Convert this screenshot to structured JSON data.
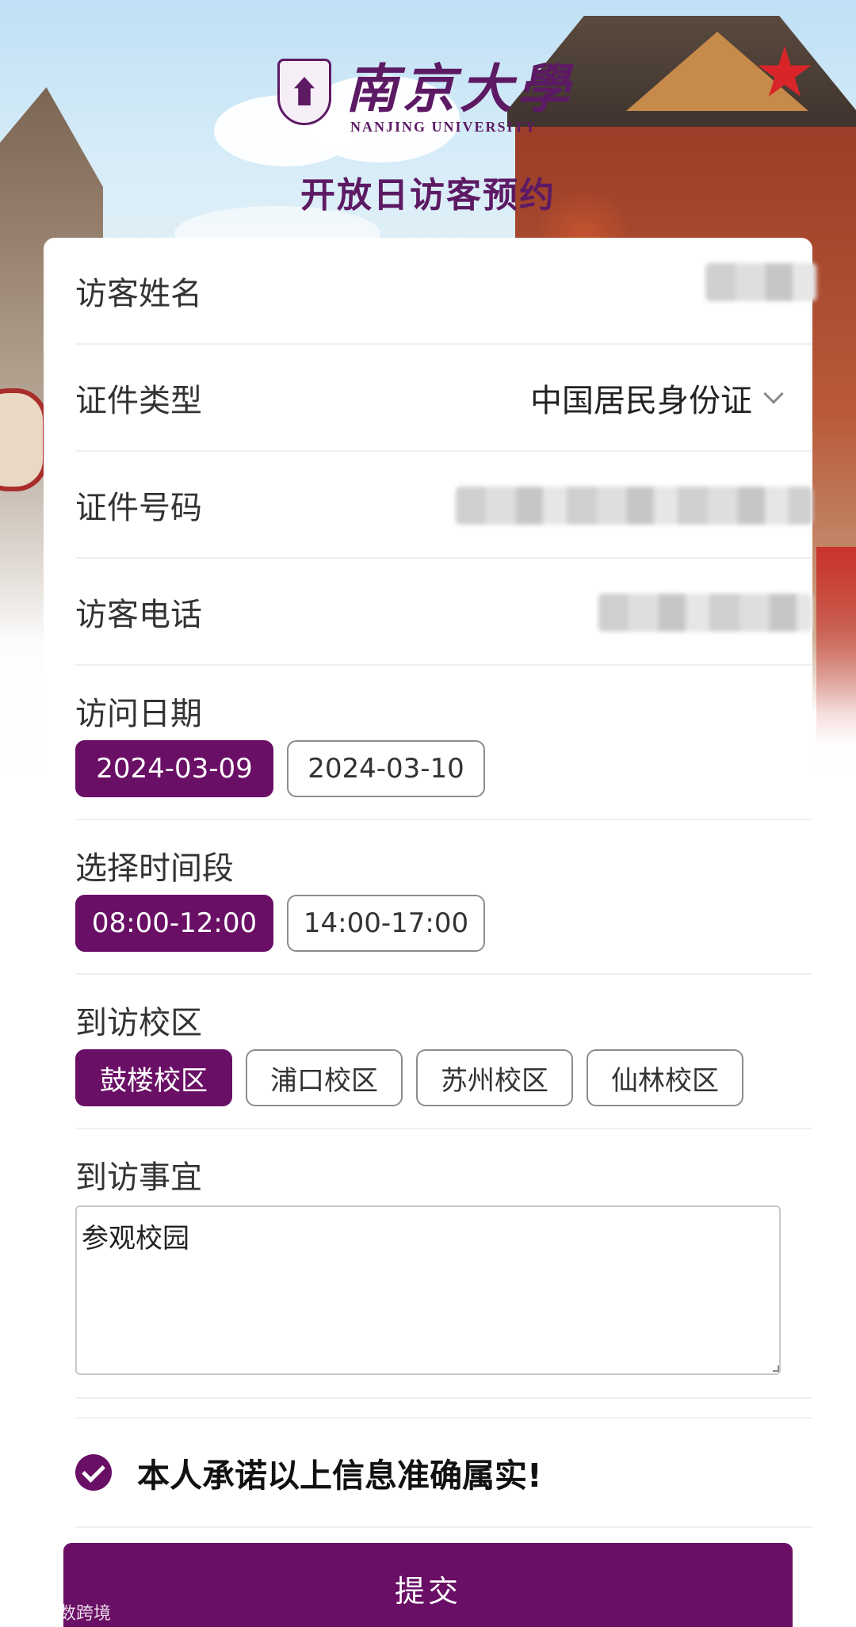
{
  "header": {
    "logo_cn": "南京大學",
    "logo_en": "NANJING UNIVERSITY",
    "title": "开放日访客预约"
  },
  "form": {
    "visitor_name": {
      "label": "访客姓名",
      "value_masked": true
    },
    "id_type": {
      "label": "证件类型",
      "value": "中国居民身份证"
    },
    "id_number": {
      "label": "证件号码",
      "value_masked": true
    },
    "visitor_phone": {
      "label": "访客电话",
      "value_masked": true
    },
    "visit_date": {
      "label": "访问日期",
      "options": [
        "2024-03-09",
        "2024-03-10"
      ],
      "selected": "2024-03-09"
    },
    "time_slot": {
      "label": "选择时间段",
      "options": [
        "08:00-12:00",
        "14:00-17:00"
      ],
      "selected": "08:00-12:00"
    },
    "campus": {
      "label": "到访校区",
      "options": [
        "鼓楼校区",
        "浦口校区",
        "苏州校区",
        "仙林校区"
      ],
      "selected": "鼓楼校区"
    },
    "purpose": {
      "label": "到访事宜",
      "value": "参观校园"
    },
    "promise": {
      "text": "本人承诺以上信息准确属实!",
      "checked": true
    }
  },
  "submit_label": "提交",
  "watermark": "大数跨境",
  "colors": {
    "primary": "#6a0f66",
    "brand_purple": "#5d1a64"
  }
}
